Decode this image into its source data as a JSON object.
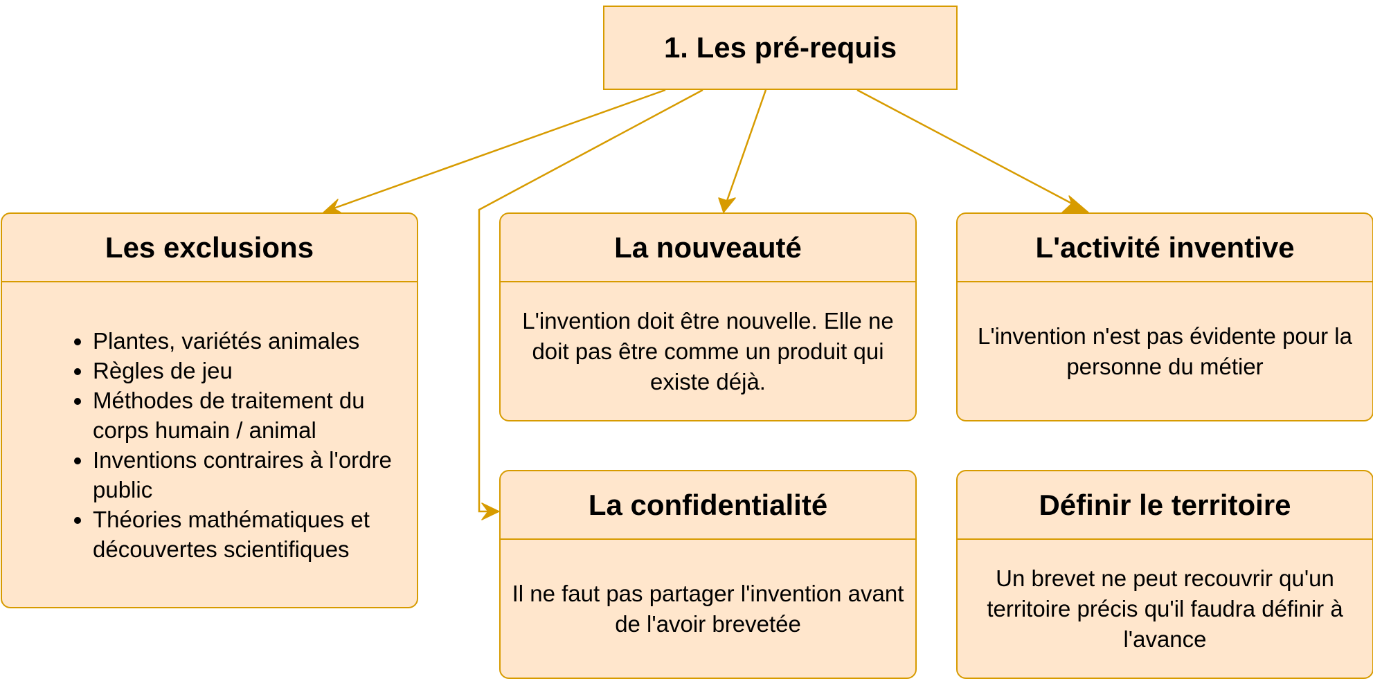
{
  "root": {
    "title": "1. Les pré-requis"
  },
  "cards": {
    "exclusions": {
      "title": "Les exclusions",
      "items": [
        "Plantes, variétés animales",
        "Règles de jeu",
        "Méthodes de traitement du corps humain / animal",
        "Inventions contraires à l'ordre public",
        "Théories mathématiques et découvertes scientifiques"
      ]
    },
    "nouveaute": {
      "title": "La nouveauté",
      "text": "L'invention doit être nouvelle. Elle ne doit pas être comme un produit qui existe déjà."
    },
    "activite": {
      "title": "L'activité inventive",
      "text": "L'invention n'est pas évidente pour la personne du métier"
    },
    "confidentialite": {
      "title": "La confidentialité",
      "text": "Il ne faut pas partager l'invention avant de l'avoir brevetée"
    },
    "territoire": {
      "title": "Définir le territoire",
      "text": "Un brevet ne peut recouvrir qu'un territoire précis qu'il faudra définir à l'avance"
    }
  },
  "colors": {
    "fill": "#ffe6cc",
    "stroke": "#d79b00"
  }
}
